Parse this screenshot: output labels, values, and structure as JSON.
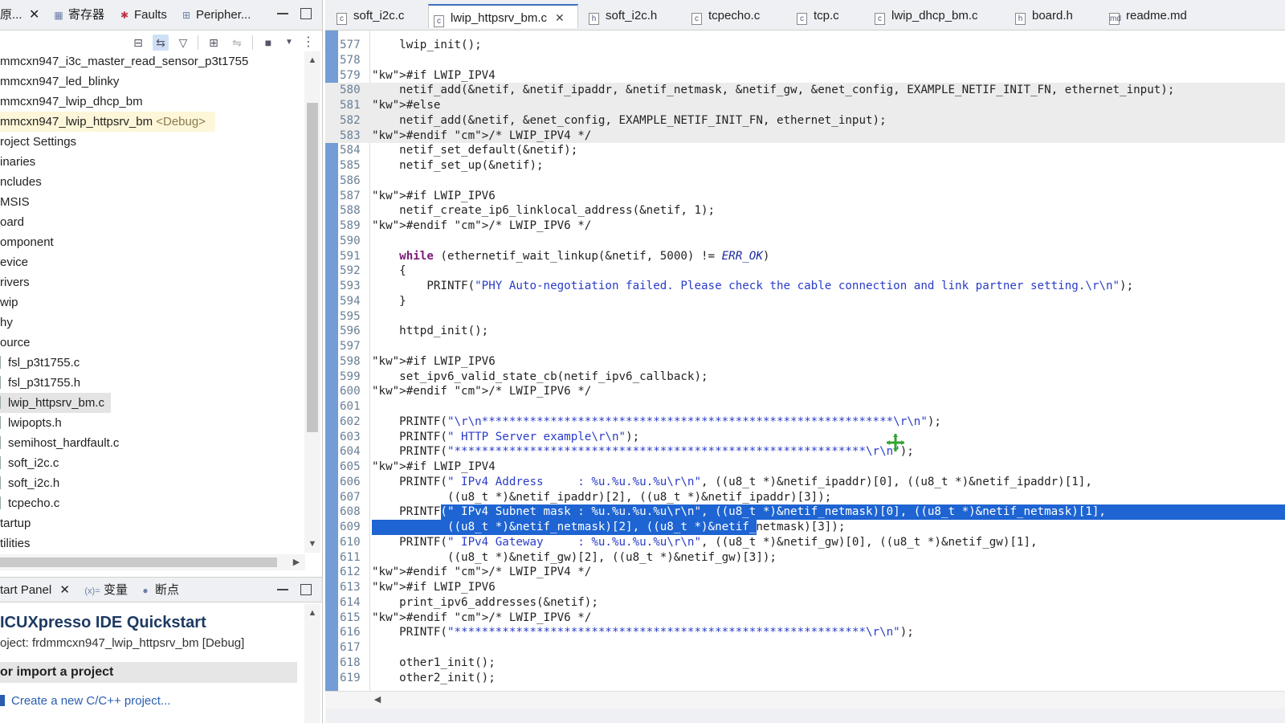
{
  "left_tabs": {
    "explorer_label": "原...",
    "registers_label": "寄存器",
    "faults_label": "Faults",
    "peripherals_label": "Peripher..."
  },
  "tree_items": [
    {
      "label": "mmcxn947_i3c_master_read_sensor_p3t1755"
    },
    {
      "label": "mmcxn947_led_blinky"
    },
    {
      "label": "mmcxn947_lwip_dhcp_bm"
    },
    {
      "label": "mmcxn947_lwip_httpsrv_bm",
      "suffix": "<Debug>"
    },
    {
      "label": "roject Settings"
    },
    {
      "label": "inaries"
    },
    {
      "label": "ncludes"
    },
    {
      "label": "MSIS"
    },
    {
      "label": "oard"
    },
    {
      "label": "omponent"
    },
    {
      "label": "evice"
    },
    {
      "label": "rivers"
    },
    {
      "label": "wip"
    },
    {
      "label": "hy"
    },
    {
      "label": "ource"
    },
    {
      "label": "fsl_p3t1755.c"
    },
    {
      "label": "fsl_p3t1755.h"
    },
    {
      "label": "lwip_httpsrv_bm.c"
    },
    {
      "label": "lwipopts.h"
    },
    {
      "label": "semihost_hardfault.c"
    },
    {
      "label": "soft_i2c.c"
    },
    {
      "label": "soft_i2c.h"
    },
    {
      "label": "tcpecho.c"
    },
    {
      "label": "tartup"
    },
    {
      "label": "tilities"
    }
  ],
  "quickstart": {
    "tab_label": "tart Panel",
    "variables_label": "变量",
    "breakpoints_label": "断点",
    "title": "ICUXpresso IDE Quickstart",
    "project": "oject: frdmmcxn947_lwip_httpsrv_bm [Debug]",
    "section": "or import a project",
    "link": "Create a new C/C++ project..."
  },
  "editor_tabs": [
    {
      "label": "soft_i2c.c",
      "icon": "c"
    },
    {
      "label": "lwip_httpsrv_bm.c",
      "icon": "c",
      "active": true
    },
    {
      "label": "soft_i2c.h",
      "icon": "h"
    },
    {
      "label": "tcpecho.c",
      "icon": "c"
    },
    {
      "label": "tcp.c",
      "icon": "c"
    },
    {
      "label": "lwip_dhcp_bm.c",
      "icon": "c"
    },
    {
      "label": "board.h",
      "icon": "h"
    },
    {
      "label": "readme.md",
      "icon": "md"
    }
  ],
  "code_lines": [
    {
      "n": "577",
      "t": "    lwip_init();"
    },
    {
      "n": "578",
      "t": ""
    },
    {
      "n": "579",
      "t": "#if LWIP_IPV4"
    },
    {
      "n": "580",
      "t": "    netif_add(&netif, &netif_ipaddr, &netif_netmask, &netif_gw, &enet_config, EXAMPLE_NETIF_INIT_FN, ethernet_input);"
    },
    {
      "n": "581",
      "t": "#else"
    },
    {
      "n": "582",
      "t": "    netif_add(&netif, &enet_config, EXAMPLE_NETIF_INIT_FN, ethernet_input);"
    },
    {
      "n": "583",
      "t": "#endif /* LWIP_IPV4 */"
    },
    {
      "n": "584",
      "t": "    netif_set_default(&netif);"
    },
    {
      "n": "585",
      "t": "    netif_set_up(&netif);"
    },
    {
      "n": "586",
      "t": ""
    },
    {
      "n": "587",
      "t": "#if LWIP_IPV6"
    },
    {
      "n": "588",
      "t": "    netif_create_ip6_linklocal_address(&netif, 1);"
    },
    {
      "n": "589",
      "t": "#endif /* LWIP_IPV6 */"
    },
    {
      "n": "590",
      "t": ""
    },
    {
      "n": "591",
      "t": "    while (ethernetif_wait_linkup(&netif, 5000) != ERR_OK)"
    },
    {
      "n": "592",
      "t": "    {"
    },
    {
      "n": "593",
      "t": "        PRINTF(\"PHY Auto-negotiation failed. Please check the cable connection and link partner setting.\\r\\n\");"
    },
    {
      "n": "594",
      "t": "    }"
    },
    {
      "n": "595",
      "t": ""
    },
    {
      "n": "596",
      "t": "    httpd_init();"
    },
    {
      "n": "597",
      "t": ""
    },
    {
      "n": "598",
      "t": "#if LWIP_IPV6"
    },
    {
      "n": "599",
      "t": "    set_ipv6_valid_state_cb(netif_ipv6_callback);"
    },
    {
      "n": "600",
      "t": "#endif /* LWIP_IPV6 */"
    },
    {
      "n": "601",
      "t": ""
    },
    {
      "n": "602",
      "t": "    PRINTF(\"\\r\\n************************************************************\\r\\n\");"
    },
    {
      "n": "603",
      "t": "    PRINTF(\" HTTP Server example\\r\\n\");"
    },
    {
      "n": "604",
      "t": "    PRINTF(\"************************************************************\\r\\n\");"
    },
    {
      "n": "605",
      "t": "#if LWIP_IPV4"
    },
    {
      "n": "606",
      "t": "    PRINTF(\" IPv4 Address     : %u.%u.%u.%u\\r\\n\", ((u8_t *)&netif_ipaddr)[0], ((u8_t *)&netif_ipaddr)[1],"
    },
    {
      "n": "607",
      "t": "           ((u8_t *)&netif_ipaddr)[2], ((u8_t *)&netif_ipaddr)[3]);"
    },
    {
      "n": "608",
      "t": "    PRINTF(\" IPv4 Subnet mask : %u.%u.%u.%u\\r\\n\", ((u8_t *)&netif_netmask)[0], ((u8_t *)&netif_netmask)[1],"
    },
    {
      "n": "609",
      "t": "           ((u8_t *)&netif_netmask)[2], ((u8_t *)&netif_netmask)[3]);"
    },
    {
      "n": "610",
      "t": "    PRINTF(\" IPv4 Gateway     : %u.%u.%u.%u\\r\\n\", ((u8_t *)&netif_gw)[0], ((u8_t *)&netif_gw)[1],"
    },
    {
      "n": "611",
      "t": "           ((u8_t *)&netif_gw)[2], ((u8_t *)&netif_gw)[3]);"
    },
    {
      "n": "612",
      "t": "#endif /* LWIP_IPV4 */"
    },
    {
      "n": "613",
      "t": "#if LWIP_IPV6"
    },
    {
      "n": "614",
      "t": "    print_ipv6_addresses(&netif);"
    },
    {
      "n": "615",
      "t": "#endif /* LWIP_IPV6 */"
    },
    {
      "n": "616",
      "t": "    PRINTF(\"************************************************************\\r\\n\");"
    },
    {
      "n": "617",
      "t": ""
    },
    {
      "n": "618",
      "t": "    other1_init();"
    },
    {
      "n": "619",
      "t": "    other2_init();"
    }
  ],
  "colors": {
    "selection": "#1e64d2",
    "keyword": "#7b1c78",
    "comment": "#4f7aa6",
    "string": "#2a3cc8",
    "inactive_code_bg": "#ececec",
    "quickstart_title": "#1d3a63"
  }
}
